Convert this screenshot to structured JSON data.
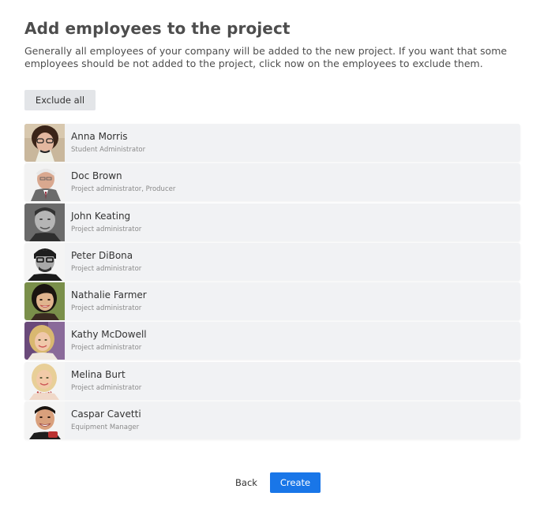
{
  "page": {
    "title": "Add employees to the project",
    "description": "Generally all employees of your company will be added to the new project. If you want that some employees should be not added to the project, click now on the employees to exclude them."
  },
  "actions": {
    "exclude_all_label": "Exclude all",
    "back_label": "Back",
    "create_label": "Create",
    "create_color": "#1976e8"
  },
  "employees": [
    {
      "name": "Anna Morris",
      "role": "Student Administrator"
    },
    {
      "name": "Doc Brown",
      "role": "Project administrator, Producer"
    },
    {
      "name": "John Keating",
      "role": "Project administrator"
    },
    {
      "name": "Peter DiBona",
      "role": "Project administrator"
    },
    {
      "name": "Nathalie Farmer",
      "role": "Project administrator"
    },
    {
      "name": "Kathy McDowell",
      "role": "Project administrator"
    },
    {
      "name": "Melina Burt",
      "role": "Project administrator"
    },
    {
      "name": "Caspar Cavetti",
      "role": "Equipment Manager"
    }
  ]
}
